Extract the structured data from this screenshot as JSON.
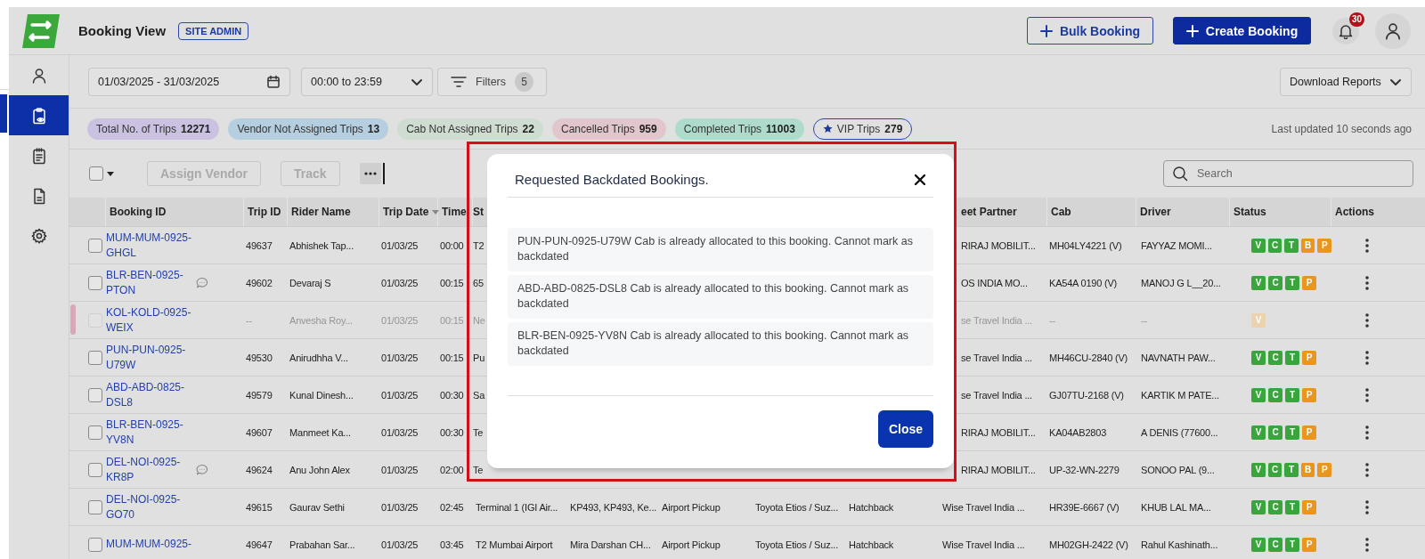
{
  "app": {
    "title": "Booking View",
    "role_badge": "SITE ADMIN"
  },
  "header_actions": [
    {
      "label": "Bulk Booking",
      "kind": "outline"
    },
    {
      "label": "Create Booking",
      "kind": "primary"
    }
  ],
  "notifications": {
    "count": "30"
  },
  "sidebar": {
    "items": [
      {
        "kind": "profile",
        "selected": false
      },
      {
        "kind": "trips",
        "selected": true
      },
      {
        "kind": "tasks",
        "selected": false
      },
      {
        "kind": "reports",
        "selected": false
      },
      {
        "kind": "settings",
        "selected": false
      }
    ]
  },
  "filters": {
    "date_range": "01/03/2025 - 31/03/2025",
    "time_range": "00:00 to 23:59",
    "filters_label": "Filters",
    "filters_count": "5",
    "download": "Download Reports"
  },
  "stats": [
    {
      "label": "Total No. of Trips",
      "count": "12271",
      "color": "#cbc2e2",
      "kind": "fill"
    },
    {
      "label": "Vendor Not Assigned Trips",
      "count": "13",
      "color": "#b6cfe0",
      "kind": "fill"
    },
    {
      "label": "Cab Not Assigned Trips",
      "count": "22",
      "color": "#cfdcd0",
      "kind": "fill"
    },
    {
      "label": "Cancelled Trips",
      "count": "959",
      "color": "#e2c6cd",
      "kind": "fill"
    },
    {
      "label": "Completed Trips",
      "count": "11003",
      "color": "#afdbcc",
      "kind": "fill"
    },
    {
      "label": "VIP Trips",
      "count": "279",
      "kind": "vip"
    }
  ],
  "last_updated": "Last updated 10 seconds ago",
  "toolbar": {
    "select_all_checked": false,
    "buttons": [
      {
        "label": "Assign Vendor",
        "disabled": true
      },
      {
        "label": "Track",
        "disabled": true
      }
    ],
    "search_placeholder": "Search"
  },
  "table": {
    "columns": [
      {
        "label": "Booking ID",
        "sorted": false
      },
      {
        "label": "Trip ID",
        "sorted": false
      },
      {
        "label": "Rider Name",
        "sorted": false
      },
      {
        "label": "Trip Date",
        "sorted": true
      },
      {
        "label": "Time",
        "sorted": false
      },
      {
        "label": "St",
        "sorted": false
      },
      {
        "label": "eet Partner",
        "sorted": false
      },
      {
        "label": "Cab",
        "sorted": false
      },
      {
        "label": "Driver",
        "sorted": false
      },
      {
        "label": "Status",
        "sorted": false
      },
      {
        "label": "Actions",
        "sorted": false
      }
    ],
    "rows": [
      {
        "booking_id": "MUM-MUM-0925-GHGL",
        "has_comment": false,
        "cancelled": false,
        "checked": false,
        "trip_id": "49637",
        "rider": "Abhishek Tap...",
        "trip_date": "01/03/25",
        "time": "00:00",
        "column_6": "T2",
        "column_11": "RIRAJ MOBILIT...",
        "cab": "MH04LY4221 (V)",
        "driver": "FAYYAZ MOMI...",
        "status": [
          {
            "label": "V",
            "color": "#3aa53c"
          },
          {
            "label": "C",
            "color": "#3aa53c"
          },
          {
            "label": "T",
            "color": "#3aa53c"
          },
          {
            "label": "B",
            "color": "#e8961e"
          },
          {
            "label": "P",
            "color": "#e8961e"
          }
        ]
      },
      {
        "booking_id": "BLR-BEN-0925-PTON",
        "has_comment": true,
        "cancelled": false,
        "checked": false,
        "trip_id": "49602",
        "rider": "Devaraj S",
        "trip_date": "01/03/25",
        "time": "00:15",
        "column_6": "65",
        "column_11": "OS INDIA MO...",
        "cab": "KA54A 0190 (V)",
        "driver": "MANOJ G L__20...",
        "status": [
          {
            "label": "V",
            "color": "#3aa53c"
          },
          {
            "label": "C",
            "color": "#3aa53c"
          },
          {
            "label": "T",
            "color": "#3aa53c"
          },
          {
            "label": "P",
            "color": "#e8961e"
          }
        ]
      },
      {
        "booking_id": "KOL-KOLD-0925-WEIX",
        "has_comment": false,
        "cancelled": true,
        "checked": false,
        "trip_id": "--",
        "rider": "Anvesha Roy...",
        "trip_date": "01/03/25",
        "time": "00:15",
        "column_6": "Ne",
        "column_11": "se Travel India ...",
        "cab": "--",
        "driver": "--",
        "status": [
          {
            "label": "V",
            "color": "#ead3ad"
          }
        ]
      },
      {
        "booking_id": "PUN-PUN-0925-U79W",
        "has_comment": false,
        "cancelled": false,
        "checked": false,
        "trip_id": "49530",
        "rider": "Anirudhha V...",
        "trip_date": "01/03/25",
        "time": "00:15",
        "column_6": "Pu",
        "column_11": "se Travel India ...",
        "cab": "MH46CU-2840 (V)",
        "driver": "NAVNATH PAW...",
        "status": [
          {
            "label": "V",
            "color": "#3aa53c"
          },
          {
            "label": "C",
            "color": "#3aa53c"
          },
          {
            "label": "T",
            "color": "#3aa53c"
          },
          {
            "label": "P",
            "color": "#e8961e"
          }
        ]
      },
      {
        "booking_id": "ABD-ABD-0825-DSL8",
        "has_comment": false,
        "cancelled": false,
        "checked": false,
        "trip_id": "49579",
        "rider": "Kunal Dinesh...",
        "trip_date": "01/03/25",
        "time": "00:30",
        "column_6": "Sa",
        "column_11": "se Travel India ...",
        "cab": "GJ07TU-2168 (V)",
        "driver": "KARTIK M PATE...",
        "status": [
          {
            "label": "V",
            "color": "#3aa53c"
          },
          {
            "label": "C",
            "color": "#3aa53c"
          },
          {
            "label": "T",
            "color": "#3aa53c"
          },
          {
            "label": "P",
            "color": "#e8961e"
          }
        ]
      },
      {
        "booking_id": "BLR-BEN-0925-YV8N",
        "has_comment": false,
        "cancelled": false,
        "checked": false,
        "trip_id": "49607",
        "rider": "Manmeet Ka...",
        "trip_date": "01/03/25",
        "time": "00:30",
        "column_6": "Te",
        "column_11": "RIRAJ MOBILIT...",
        "cab": "KA04AB2803",
        "driver": "A DENIS (77600...",
        "status": [
          {
            "label": "V",
            "color": "#3aa53c"
          },
          {
            "label": "C",
            "color": "#3aa53c"
          },
          {
            "label": "T",
            "color": "#3aa53c"
          },
          {
            "label": "P",
            "color": "#e8961e"
          }
        ]
      },
      {
        "booking_id": "DEL-NOI-0925-KR8P",
        "has_comment": true,
        "cancelled": false,
        "checked": false,
        "trip_id": "49624",
        "rider": "Anu John Alex",
        "trip_date": "01/03/25",
        "time": "02:00",
        "column_6": "Te",
        "column_11": "RIRAJ MOBILIT...",
        "cab": "UP-32-WN-2279",
        "driver": "SONOO PAL (9...",
        "status": [
          {
            "label": "V",
            "color": "#3aa53c"
          },
          {
            "label": "C",
            "color": "#3aa53c"
          },
          {
            "label": "T",
            "color": "#3aa53c"
          },
          {
            "label": "B",
            "color": "#e8961e"
          },
          {
            "label": "P",
            "color": "#e8961e"
          }
        ]
      },
      {
        "booking_id": "DEL-NOI-0925-GO70",
        "has_comment": false,
        "cancelled": false,
        "checked": false,
        "trip_id": "49615",
        "rider": "Gaurav Sethi",
        "trip_date": "01/03/25",
        "time": "02:45",
        "column_6": "Terminal 1 (IGI Air...",
        "column_7": "KP493, KP493, Ke...",
        "column_8": "Airport Pickup",
        "column_9": "Toyota Etios / Suz...",
        "column_10": "Hatchback",
        "column_11": "Wise Travel India ...",
        "cab": "HR39E-6667 (V)",
        "driver": "KHUB LAL MA...",
        "status": [
          {
            "label": "V",
            "color": "#3aa53c"
          },
          {
            "label": "C",
            "color": "#3aa53c"
          },
          {
            "label": "T",
            "color": "#3aa53c"
          },
          {
            "label": "P",
            "color": "#e8961e"
          }
        ]
      },
      {
        "booking_id": "MUM-MUM-0925-",
        "has_comment": false,
        "cancelled": false,
        "checked": false,
        "trip_id": "49647",
        "rider": "Prabahan Sar...",
        "trip_date": "01/03/25",
        "time": "03:45",
        "column_6": "T2 Mumbai Airport",
        "column_7": "Mira Darshan CH...",
        "column_8": "Airport Pickup",
        "column_9": "Toyota Etios / Suz...",
        "column_10": "Hatchback",
        "column_11": "Wise Travel India ...",
        "cab": "MH02GH-2422 (V)",
        "driver": "Rahul Kashinath...",
        "status": [
          {
            "label": "V",
            "color": "#3aa53c"
          },
          {
            "label": "C",
            "color": "#3aa53c"
          },
          {
            "label": "T",
            "color": "#3aa53c"
          },
          {
            "label": "P",
            "color": "#e8961e"
          }
        ]
      }
    ]
  },
  "modal": {
    "title": "Requested Backdated Bookings.",
    "messages": [
      "PUN-PUN-0925-U79W Cab is already allocated to this booking. Cannot mark as backdated",
      "ABD-ABD-0825-DSL8 Cab is already allocated to this booking. Cannot mark as backdated",
      "BLR-BEN-0925-YV8N Cab is already allocated to this booking. Cannot mark as backdated"
    ],
    "close_label": "Close"
  }
}
